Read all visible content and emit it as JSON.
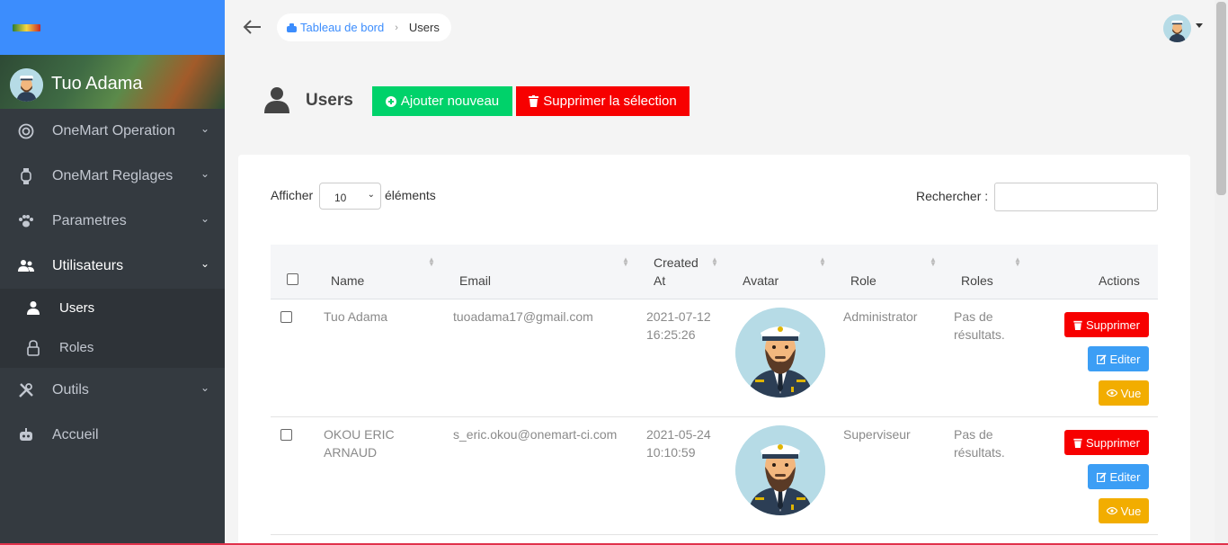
{
  "sidebar": {
    "user_name": "Tuo Adama",
    "items": [
      {
        "label": "OneMart Operation"
      },
      {
        "label": "OneMart Reglages"
      },
      {
        "label": "Parametres"
      },
      {
        "label": "Utilisateurs"
      },
      {
        "label": "Outils"
      },
      {
        "label": "Accueil"
      }
    ],
    "sub_items": [
      {
        "label": "Users"
      },
      {
        "label": "Roles"
      }
    ]
  },
  "breadcrumb": {
    "home": "Tableau de bord",
    "current": "Users"
  },
  "header": {
    "title": "Users",
    "add_label": "Ajouter nouveau",
    "delete_selected_label": "Supprimer la sélection"
  },
  "table_controls": {
    "show_label": "Afficher",
    "page_size": "10",
    "elements_label": "éléments",
    "search_label": "Rechercher :"
  },
  "table": {
    "columns": [
      "Name",
      "Email",
      "Created At",
      "Avatar",
      "Role",
      "Roles",
      "Actions"
    ],
    "created_col_line1": "Created",
    "created_col_line2": "At",
    "rows": [
      {
        "name_l1": "Tuo Adama",
        "name_l2": "",
        "email": "tuoadama17@gmail.com",
        "date": "2021-07-12",
        "time": "16:25:26",
        "role": "Administrator",
        "roles_l1": "Pas de",
        "roles_l2": "résultats."
      },
      {
        "name_l1": "OKOU ERIC",
        "name_l2": "ARNAUD",
        "email": "s_eric.okou@onemart-ci.com",
        "date": "2021-05-24",
        "time": "10:10:59",
        "role": "Superviseur",
        "roles_l1": "Pas de",
        "roles_l2": "résultats."
      }
    ],
    "actions": {
      "delete": "Supprimer",
      "edit": "Editer",
      "view": "Vue"
    }
  },
  "colors": {
    "brand": "#3c8dfd",
    "sidebar": "#343a40",
    "add": "#00d26a",
    "danger": "#f70000",
    "info": "#3c9ef5",
    "warning": "#f2ad00"
  }
}
